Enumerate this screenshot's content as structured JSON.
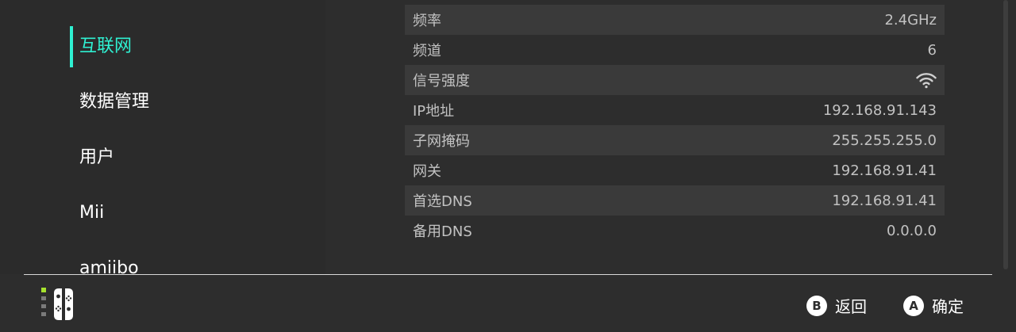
{
  "sidebar": {
    "items": [
      {
        "label": "互联网",
        "active": true
      },
      {
        "label": "数据管理"
      },
      {
        "label": "用户"
      },
      {
        "label": "Mii"
      },
      {
        "label": "amiibo"
      }
    ]
  },
  "network_info": {
    "rows": [
      {
        "label": "频率",
        "value": "2.4GHz"
      },
      {
        "label": "频道",
        "value": "6"
      },
      {
        "label": "信号强度",
        "value": "",
        "icon": "wifi-signal-icon"
      },
      {
        "label": "IP地址",
        "value": "192.168.91.143"
      },
      {
        "label": "子网掩码",
        "value": "255.255.255.0"
      },
      {
        "label": "网关",
        "value": "192.168.91.41"
      },
      {
        "label": "首选DNS",
        "value": "192.168.91.41"
      },
      {
        "label": "备用DNS",
        "value": "0.0.0.0"
      }
    ]
  },
  "footer": {
    "back_key": "B",
    "back_label": "返回",
    "confirm_key": "A",
    "confirm_label": "确定"
  },
  "colors": {
    "accent": "#2ff0d2",
    "background": "#2d2d2d",
    "row_alt": "#3a3a3a"
  }
}
